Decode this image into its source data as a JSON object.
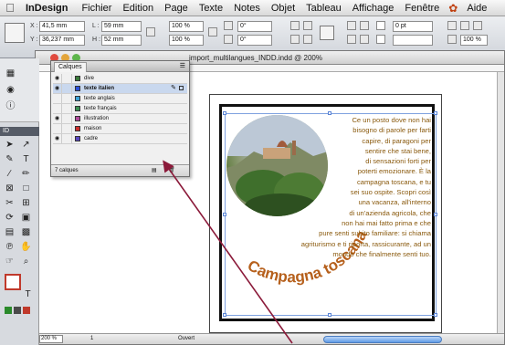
{
  "menubar": {
    "app": "InDesign",
    "items": [
      "Fichier",
      "Edition",
      "Page",
      "Texte",
      "Notes",
      "Objet",
      "Tableau",
      "Affichage",
      "Fenêtre",
      "Aide"
    ]
  },
  "control": {
    "x_label": "X :",
    "x_value": "41,5 mm",
    "y_label": "Y :",
    "y_value": "36,237 mm",
    "l_label": "L :",
    "l_value": "59 mm",
    "h_label": "H :",
    "h_value": "52 mm",
    "scale_x": "100 %",
    "scale_y": "100 %",
    "angle": "0°",
    "shear": "0°",
    "stroke": "0 pt",
    "pct": "100 %"
  },
  "tools": {
    "header": "ID"
  },
  "document": {
    "title": "import_multilangues_INDD.indd @ 200%",
    "zoom": "200 %",
    "page_nav": "1",
    "state": "Ouvert"
  },
  "layers_panel": {
    "tab": "Calques",
    "layers": [
      {
        "name": "dive",
        "color": "#3a7a3a",
        "visible": true,
        "selected": false
      },
      {
        "name": "texte italien",
        "color": "#2b4fd8",
        "visible": true,
        "selected": true
      },
      {
        "name": "texte anglais",
        "color": "#3ba1d5",
        "visible": false,
        "selected": false
      },
      {
        "name": "texte français",
        "color": "#3b8f52",
        "visible": false,
        "selected": false
      },
      {
        "name": "illustration",
        "color": "#b04a9c",
        "visible": true,
        "selected": false
      },
      {
        "name": "maison",
        "color": "#cc2d2d",
        "visible": false,
        "selected": false
      },
      {
        "name": "cadre",
        "color": "#5a46c0",
        "visible": true,
        "selected": false
      }
    ],
    "footer": "7 calques"
  },
  "artwork": {
    "headline": "Campagna toscana",
    "headline_color": "#b6601c",
    "body_color": "#8a5a0e",
    "body_lines": [
      "Ce un posto dove non hai",
      "bisogno di parole per farti",
      "capire, di paragoni per",
      "sentire che stai bene,",
      "di sensazioni forti per",
      "poterti emozionare. È la",
      "campagna toscana, e tu",
      "sei suo ospite. Scopri così",
      "una vacanza, all'interno",
      "di un'azienda agricola, che",
      "non hai mai fatto prima e che",
      "pure senti subito familiare: si chiama",
      "agriturismo e ti riporta, rassicurante, ad un",
      "mondo che finalmente senti tuo."
    ]
  }
}
